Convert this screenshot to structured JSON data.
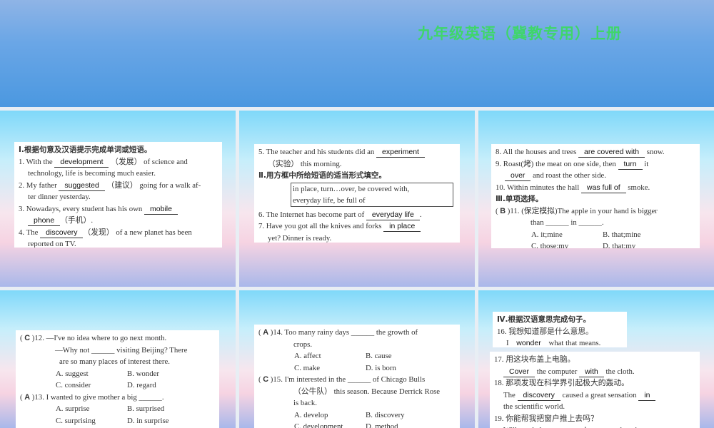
{
  "header": {
    "title": "九年级英语（冀教专用）上册"
  },
  "panels": [
    {
      "cards": [
        {
          "lines": [
            {
              "kind": "head",
              "segs": [
                {
                  "t": "Ⅰ.根据句意及汉语提示完成单词或短语。"
                }
              ]
            },
            {
              "kind": "",
              "segs": [
                {
                  "t": "1. With the "
                },
                {
                  "a": "development"
                },
                {
                  "t": " （发展） of science and"
                }
              ]
            },
            {
              "kind": "cont",
              "segs": [
                {
                  "t": "technology, life is becoming much easier."
                }
              ]
            },
            {
              "kind": "",
              "segs": [
                {
                  "t": "2. My father "
                },
                {
                  "a": "suggested"
                },
                {
                  "t": " （建议） going for a walk af-"
                }
              ]
            },
            {
              "kind": "cont",
              "segs": [
                {
                  "t": "ter dinner yesterday."
                }
              ]
            },
            {
              "kind": "",
              "segs": [
                {
                  "t": "3. Nowadays, every student has his own "
                },
                {
                  "a": "mobile"
                }
              ]
            },
            {
              "kind": "cont",
              "segs": [
                {
                  "a": "phone"
                },
                {
                  "t": "（手机）."
                }
              ]
            },
            {
              "kind": "",
              "segs": [
                {
                  "t": "4. The "
                },
                {
                  "a": "discovery"
                },
                {
                  "t": "（发现） of a new planet has been"
                }
              ]
            },
            {
              "kind": "cont",
              "segs": [
                {
                  "t": "reported on TV."
                }
              ]
            }
          ]
        }
      ]
    },
    {
      "cards": [
        {
          "lines": [
            {
              "kind": "",
              "segs": [
                {
                  "t": "5. The teacher and his students did an "
                },
                {
                  "a": "experiment"
                }
              ]
            },
            {
              "kind": "cont",
              "segs": [
                {
                  "t": "（实验） this morning."
                }
              ]
            },
            {
              "kind": "head",
              "segs": [
                {
                  "t": "Ⅱ.用方框中所给短语的适当形式填空。"
                }
              ]
            },
            {
              "kind": "box",
              "box": [
                "in place, turn…over, be covered with,",
                "everyday life, be full of"
              ]
            },
            {
              "kind": "",
              "segs": [
                {
                  "t": "6. The Internet has become part of "
                },
                {
                  "a": "everyday life"
                },
                {
                  "t": "."
                }
              ]
            },
            {
              "kind": "",
              "segs": [
                {
                  "t": "7. Have you got all the knives and forks "
                },
                {
                  "a": "in place"
                }
              ]
            },
            {
              "kind": "cont",
              "segs": [
                {
                  "t": "yet? Dinner is ready."
                }
              ]
            }
          ]
        }
      ]
    },
    {
      "cards": [
        {
          "lines": [
            {
              "kind": "",
              "segs": [
                {
                  "t": "8. All the houses and trees "
                },
                {
                  "a": "are covered with"
                },
                {
                  "t": " snow."
                }
              ]
            },
            {
              "kind": "",
              "segs": [
                {
                  "t": "9. Roast(烤) the meat on one side, then "
                },
                {
                  "a": "turn"
                },
                {
                  "t": " it"
                }
              ]
            },
            {
              "kind": "cont",
              "segs": [
                {
                  "a": "over"
                },
                {
                  "t": " and roast the other side."
                }
              ]
            },
            {
              "kind": "",
              "segs": [
                {
                  "t": "10. Within minutes the hall "
                },
                {
                  "a": "was full of"
                },
                {
                  "t": " smoke."
                }
              ]
            },
            {
              "kind": "head",
              "segs": [
                {
                  "t": "Ⅲ.单项选择。"
                }
              ]
            },
            {
              "kind": "",
              "segs": [
                {
                  "q": "B"
                },
                {
                  "t": "11. (保定模拟)The apple in your hand is bigger"
                }
              ]
            },
            {
              "kind": "cont2",
              "segs": [
                {
                  "t": "than ______ in ______."
                }
              ]
            },
            {
              "kind": "opts",
              "opts": [
                "A. it;mine",
                "B. that;mine"
              ]
            },
            {
              "kind": "opts",
              "opts": [
                "C. those;my",
                "D. that;my"
              ]
            }
          ]
        }
      ]
    },
    {
      "cards": [
        {
          "lines": [
            {
              "kind": "",
              "segs": [
                {
                  "q": "C"
                },
                {
                  "t": "12. —I've no idea where to go next month."
                }
              ]
            },
            {
              "kind": "cont2",
              "segs": [
                {
                  "t": "—Why not ______ visiting Beijing? There"
                }
              ]
            },
            {
              "kind": "cont3",
              "segs": [
                {
                  "t": "are so many places of interest there."
                }
              ]
            },
            {
              "kind": "opts",
              "opts": [
                "A. suggest",
                "B. wonder"
              ]
            },
            {
              "kind": "opts",
              "opts": [
                "C. consider",
                "D. regard"
              ]
            },
            {
              "kind": "",
              "segs": [
                {
                  "q": "A"
                },
                {
                  "t": "13. I wanted to give mother a big ______."
                }
              ]
            },
            {
              "kind": "opts",
              "opts": [
                "A. surprise",
                "B. surprised"
              ]
            },
            {
              "kind": "opts",
              "opts": [
                "C. surprising",
                "D. in surprise"
              ]
            }
          ]
        }
      ]
    },
    {
      "cards": [
        {
          "lines": [
            {
              "kind": "",
              "segs": [
                {
                  "q": "A"
                },
                {
                  "t": "14. Too many rainy days ______ the growth of"
                }
              ]
            },
            {
              "kind": "cont2",
              "segs": [
                {
                  "t": "crops."
                }
              ]
            },
            {
              "kind": "opts",
              "opts": [
                "A. affect",
                "B. cause"
              ]
            },
            {
              "kind": "opts",
              "opts": [
                "C. make",
                "D. is born"
              ]
            },
            {
              "kind": "",
              "segs": [
                {
                  "q": "C"
                },
                {
                  "t": "15. I'm interested in the ______ of Chicago Bulls"
                }
              ]
            },
            {
              "kind": "cont2",
              "segs": [
                {
                  "t": "（公牛队） this season. Because Derrick Rose"
                }
              ]
            },
            {
              "kind": "cont2",
              "segs": [
                {
                  "t": "is back."
                }
              ]
            },
            {
              "kind": "opts",
              "opts": [
                "A. develop",
                "B. discovery"
              ]
            },
            {
              "kind": "opts",
              "opts": [
                "C. development",
                "D. method"
              ]
            }
          ]
        }
      ]
    },
    {
      "cards": [
        {
          "lines": [
            {
              "kind": "head",
              "segs": [
                {
                  "t": "Ⅳ.根据汉语意思完成句子。"
                }
              ]
            },
            {
              "kind": "",
              "segs": [
                {
                  "t": "16. 我想知道那是什么意思。"
                }
              ]
            },
            {
              "kind": "cont",
              "segs": [
                {
                  "t": "I "
                },
                {
                  "a": "wonder"
                },
                {
                  "t": " what that means."
                }
              ]
            }
          ]
        },
        {
          "lines": [
            {
              "kind": "",
              "segs": [
                {
                  "t": "17. 用这块布盖上电脑。"
                }
              ]
            },
            {
              "kind": "cont",
              "segs": [
                {
                  "a": "Cover"
                },
                {
                  "t": " the computer "
                },
                {
                  "a": "with"
                },
                {
                  "t": " the cloth."
                }
              ]
            },
            {
              "kind": "",
              "segs": [
                {
                  "t": "18. 那项发现在科学界引起极大的轰动。"
                }
              ]
            },
            {
              "kind": "cont",
              "segs": [
                {
                  "t": "The "
                },
                {
                  "a": "discovery"
                },
                {
                  "t": " caused a great sensation "
                },
                {
                  "a": "in"
                }
              ]
            },
            {
              "kind": "cont",
              "segs": [
                {
                  "t": "the scientific world."
                }
              ]
            },
            {
              "kind": "",
              "segs": [
                {
                  "t": "19. 你能帮我把窗户推上去吗？"
                }
              ]
            },
            {
              "kind": "cont",
              "segs": [
                {
                  "t": "Will you help me to "
                },
                {
                  "a": "push"
                },
                {
                  "t": " "
                },
                {
                  "a": "up"
                },
                {
                  "t": " the win-"
                }
              ]
            }
          ]
        }
      ]
    }
  ]
}
